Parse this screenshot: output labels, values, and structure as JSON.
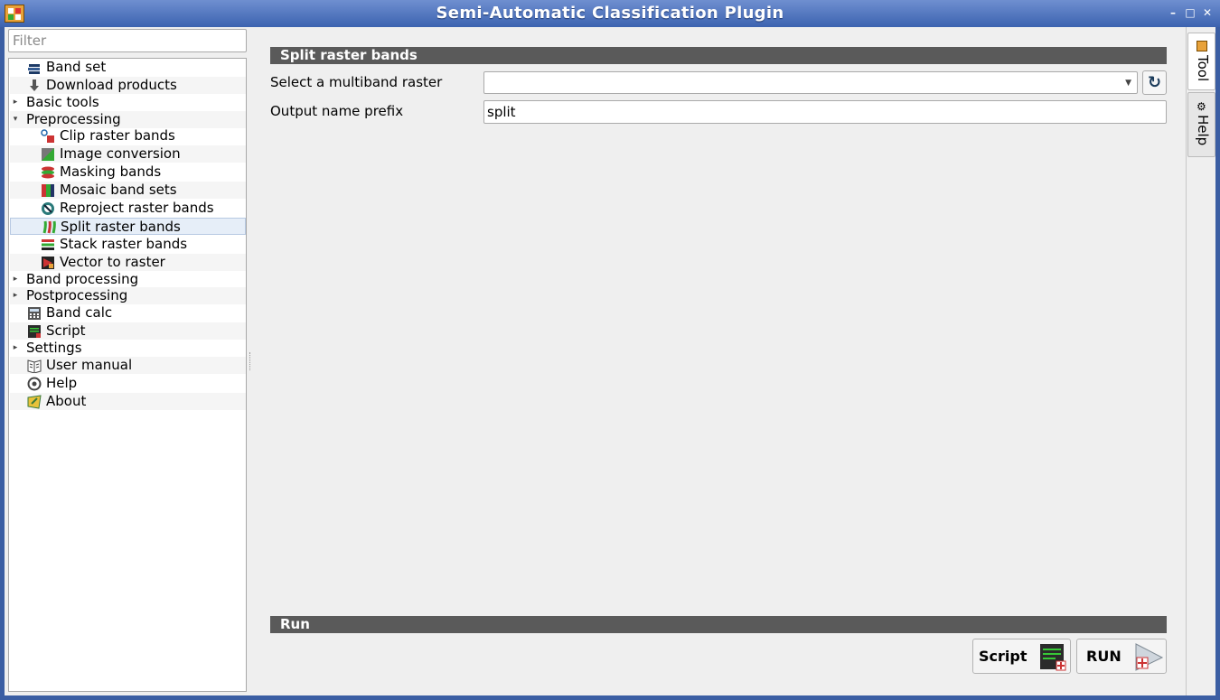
{
  "window": {
    "title": "Semi-Automatic Classification Plugin",
    "controls": [
      "–",
      "□",
      "✕"
    ]
  },
  "filter": {
    "placeholder": "Filter",
    "value": ""
  },
  "tree": [
    {
      "label": "Band set",
      "level": 1,
      "icon": "band-set-icon"
    },
    {
      "label": "Download products",
      "level": 1,
      "icon": "download-icon"
    },
    {
      "label": "Basic tools",
      "level": 0,
      "caret": "▸"
    },
    {
      "label": "Preprocessing",
      "level": 0,
      "caret": "▾"
    },
    {
      "label": "Clip raster bands",
      "level": 2,
      "icon": "clip-icon"
    },
    {
      "label": "Image conversion",
      "level": 2,
      "icon": "image-conversion-icon"
    },
    {
      "label": "Masking bands",
      "level": 2,
      "icon": "masking-icon"
    },
    {
      "label": "Mosaic band sets",
      "level": 2,
      "icon": "mosaic-icon"
    },
    {
      "label": "Reproject raster bands",
      "level": 2,
      "icon": "reproject-icon"
    },
    {
      "label": "Split raster bands",
      "level": 2,
      "icon": "split-icon",
      "selected": true
    },
    {
      "label": "Stack raster bands",
      "level": 2,
      "icon": "stack-icon"
    },
    {
      "label": "Vector to raster",
      "level": 2,
      "icon": "vector-to-raster-icon"
    },
    {
      "label": "Band processing",
      "level": 0,
      "caret": "▸"
    },
    {
      "label": "Postprocessing",
      "level": 0,
      "caret": "▸"
    },
    {
      "label": "Band calc",
      "level": 1,
      "icon": "calculator-icon"
    },
    {
      "label": "Script",
      "level": 1,
      "icon": "script-icon"
    },
    {
      "label": "Settings",
      "level": 0,
      "caret": "▸"
    },
    {
      "label": "User manual",
      "level": 1,
      "icon": "manual-icon"
    },
    {
      "label": "Help",
      "level": 1,
      "icon": "help-icon"
    },
    {
      "label": "About",
      "level": 1,
      "icon": "about-icon"
    }
  ],
  "panel": {
    "section_title": "Split raster bands",
    "raster_label": "Select a multiband raster",
    "raster_value": "",
    "prefix_label": "Output name prefix",
    "prefix_value": "split"
  },
  "run": {
    "section_title": "Run",
    "script_label": "Script",
    "run_label": "RUN"
  },
  "side_tabs": [
    {
      "label": "Tool",
      "active": true,
      "icon": "tool-icon"
    },
    {
      "label": "Help",
      "active": false,
      "icon": "gear-icon"
    }
  ],
  "colors": {
    "titlebar": "#3c63b0",
    "section_header": "#5a5a5a",
    "selection": "#e6eef8"
  }
}
